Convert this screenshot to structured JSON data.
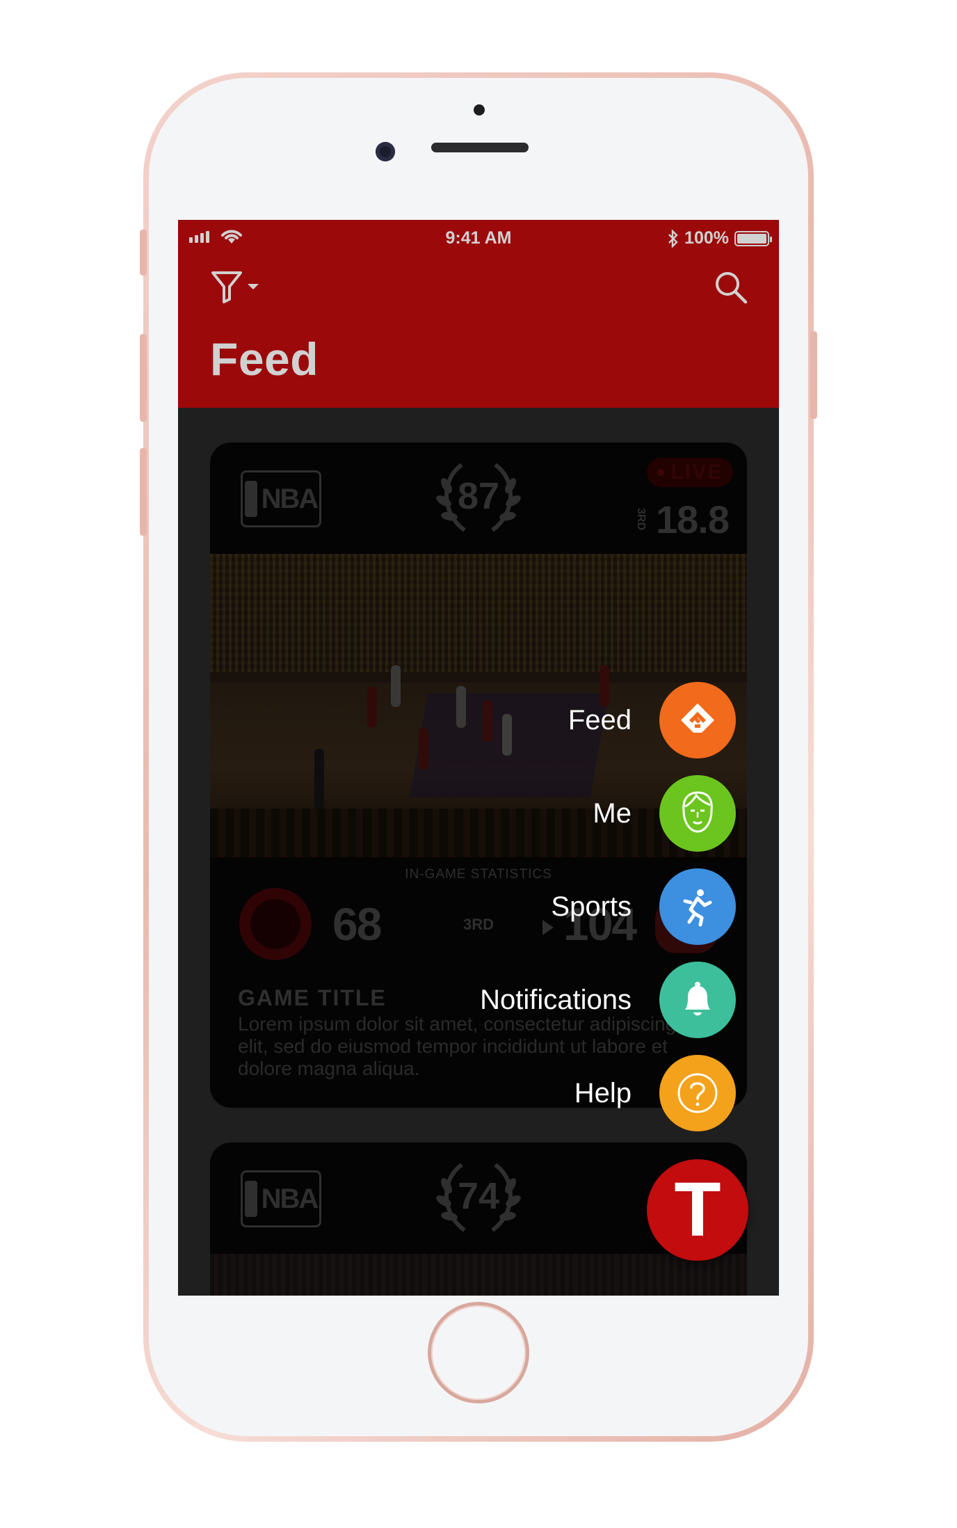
{
  "status_bar": {
    "time": "9:41 AM",
    "battery": "100%"
  },
  "header": {
    "title": "Feed"
  },
  "cards": [
    {
      "league": "NBA",
      "rank": "87",
      "live": "LIVE",
      "period_marker": "3RD",
      "clock": "18.8",
      "stats_header": "IN-GAME STATISTICS",
      "home_score": "68",
      "quarter": "3RD",
      "away_score": "104",
      "title": "GAME TITLE",
      "description": "Lorem ipsum dolor sit amet, consectetur adipiscing elit, sed do eiusmod tempor incididunt ut labore et dolore magna aliqua."
    },
    {
      "league": "NBA",
      "rank": "74"
    }
  ],
  "fab_menu": {
    "items": [
      {
        "label": "Feed",
        "icon": "feedly-icon",
        "color": "#f26a1b"
      },
      {
        "label": "Me",
        "icon": "face-icon",
        "color": "#6cc51f"
      },
      {
        "label": "Sports",
        "icon": "athlete-icon",
        "color": "#3d8fe0"
      },
      {
        "label": "Notifications",
        "icon": "bell-icon",
        "color": "#3dbf9b"
      },
      {
        "label": "Help",
        "icon": "question-icon",
        "color": "#f4a21b"
      }
    ],
    "main_label": "T",
    "main_color": "#c20c0d"
  },
  "colors": {
    "app_red": "#bf0c0d",
    "background": "#262626"
  }
}
